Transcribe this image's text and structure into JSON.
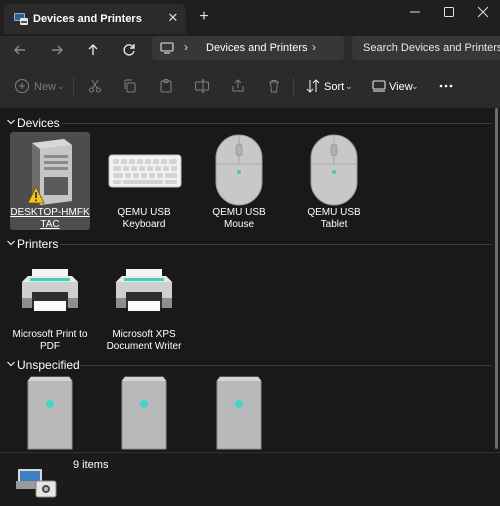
{
  "tab": {
    "title": "Devices and Printers"
  },
  "address": {
    "location": "Devices and Printers"
  },
  "search": {
    "placeholder": "Search Devices and Printers"
  },
  "toolbar": {
    "new_label": "New",
    "sort_label": "Sort",
    "view_label": "View"
  },
  "groups": {
    "devices": {
      "title": "Devices"
    },
    "printers": {
      "title": "Printers"
    },
    "unspecified": {
      "title": "Unspecified"
    }
  },
  "devices": [
    {
      "label": "DESKTOP-HMFK TAC",
      "icon": "computer-tower-warning-icon",
      "selected": true
    },
    {
      "label": "QEMU USB Keyboard",
      "icon": "keyboard-icon"
    },
    {
      "label": "QEMU USB Mouse",
      "icon": "mouse-icon"
    },
    {
      "label": "QEMU USB Tablet",
      "icon": "mouse-icon"
    }
  ],
  "printers": [
    {
      "label": "Microsoft Print to PDF",
      "icon": "printer-icon"
    },
    {
      "label": "Microsoft XPS Document Writer",
      "icon": "printer-icon"
    }
  ],
  "unspecified": [
    {
      "icon": "generic-device-icon"
    },
    {
      "icon": "generic-device-icon"
    },
    {
      "icon": "generic-device-icon"
    }
  ],
  "status": {
    "item_count": "9 items"
  },
  "colors": {
    "accent_teal": "#40d6c8",
    "background": "#191919",
    "toolbar": "#2b2b2b",
    "selection": "#4d4d4d"
  }
}
